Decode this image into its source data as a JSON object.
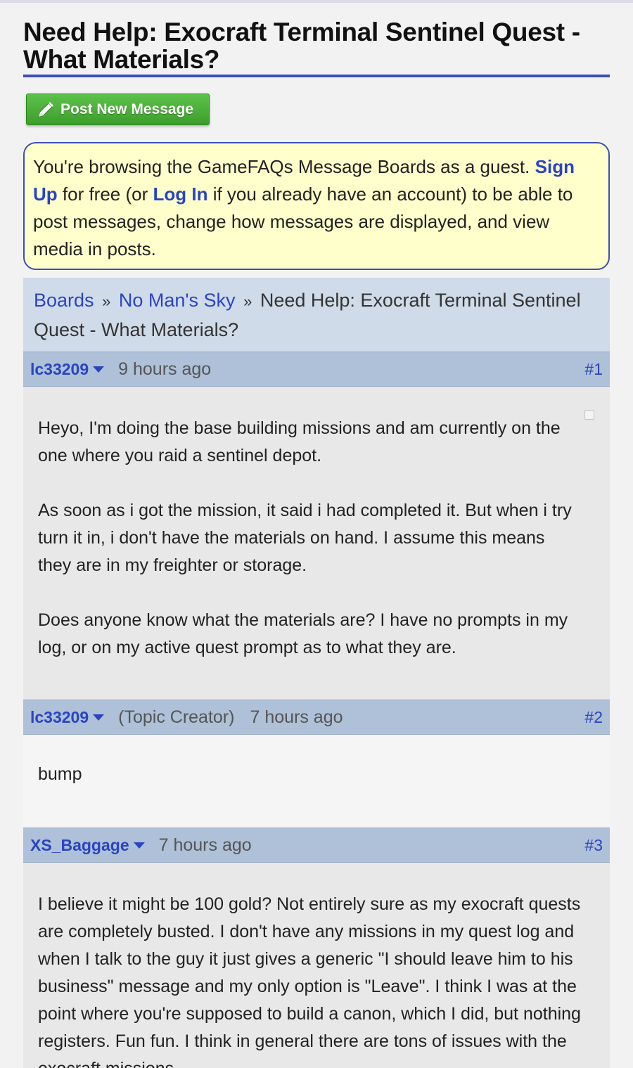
{
  "page": {
    "title": "Need Help: Exocraft Terminal Sentinel Quest - What Materials?"
  },
  "post_button": {
    "label": "Post New Message",
    "icon": "pencil-icon"
  },
  "guest_notice": {
    "text_1": "You're browsing the GameFAQs Message Boards as a guest.",
    "sign_up": "Sign Up",
    "text_2": " for free (or ",
    "log_in": "Log In",
    "text_3": " if you already have an account) to be able to post messages, change how messages are displayed, and view media in posts."
  },
  "breadcrumb": {
    "boards": "Boards",
    "separator": "»",
    "game": "No Man's Sky",
    "topic": "Need Help: Exocraft Terminal Sentinel Quest - What Materials?"
  },
  "messages": [
    {
      "user": "lc33209",
      "tag": "",
      "time": "9 hours ago",
      "number": "#1",
      "paragraphs": [
        "Heyo, I'm doing the base building missions and am currently on the one where you raid a sentinel depot.",
        "As soon as i got the mission, it said i had completed it. But when i try turn it in, i don't have the materials on hand. I assume this means they are in my freighter or storage.",
        "Does anyone know what the materials are? I have no prompts in my log, or on my active quest prompt as to what they are."
      ]
    },
    {
      "user": "lc33209",
      "tag": "(Topic Creator)",
      "time": "7 hours ago",
      "number": "#2",
      "paragraphs": [
        "bump"
      ]
    },
    {
      "user": "XS_Baggage",
      "tag": "",
      "time": "7 hours ago",
      "number": "#3",
      "paragraphs": [
        "I believe it might be 100 gold? Not entirely sure as my exocraft quests are completely busted. I don't have any missions in my quest log and when I talk to the guy it just gives a generic \"I should leave him to his business\" message and my only option is \"Leave\". I think I was at the point where you're supposed to build a canon, which I did, but nothing registers. Fun fun. I think in general there are tons of issues with the exocraft missions."
      ]
    }
  ],
  "colors": {
    "accent_blue": "#2a44c2",
    "title_rule": "#3c4fb8",
    "button_green": "#4aae38",
    "notice_bg": "#ffffcc",
    "header_bg": "#aec1d8",
    "breadcrumb_bg": "#d0dbe9"
  }
}
